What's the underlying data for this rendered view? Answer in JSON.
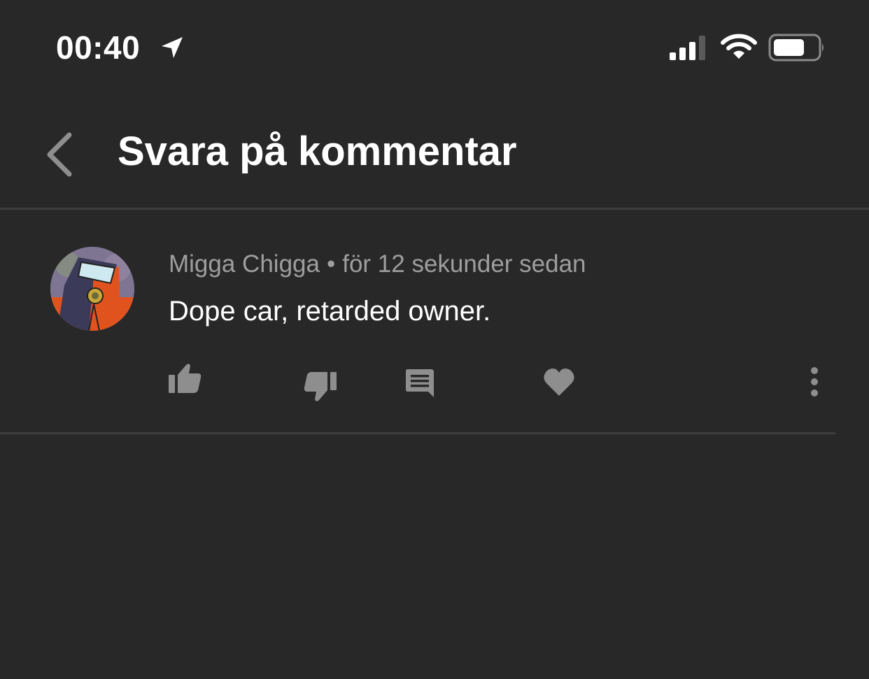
{
  "status_bar": {
    "time": "00:40",
    "icons": [
      "location-arrow-icon",
      "cellular-signal-icon",
      "wifi-icon",
      "battery-icon"
    ]
  },
  "header": {
    "back_icon": "chevron-left-icon",
    "title": "Svara på kommentar"
  },
  "comment": {
    "author": "Migga Chigga",
    "separator": "•",
    "timestamp": "för 12 sekunder sedan",
    "text": "Dope car, retarded owner.",
    "actions": [
      {
        "name": "like",
        "icon": "thumbs-up-icon"
      },
      {
        "name": "dislike",
        "icon": "thumbs-down-icon"
      },
      {
        "name": "reply",
        "icon": "comment-icon"
      },
      {
        "name": "heart",
        "icon": "heart-icon"
      },
      {
        "name": "more",
        "icon": "more-vertical-icon"
      }
    ]
  },
  "colors": {
    "background": "#282828",
    "divider": "#3d3d3d",
    "secondary_text": "#9e9e9e",
    "icon_gray": "#8e8e8e",
    "avatar_orange": "#e0531f"
  }
}
